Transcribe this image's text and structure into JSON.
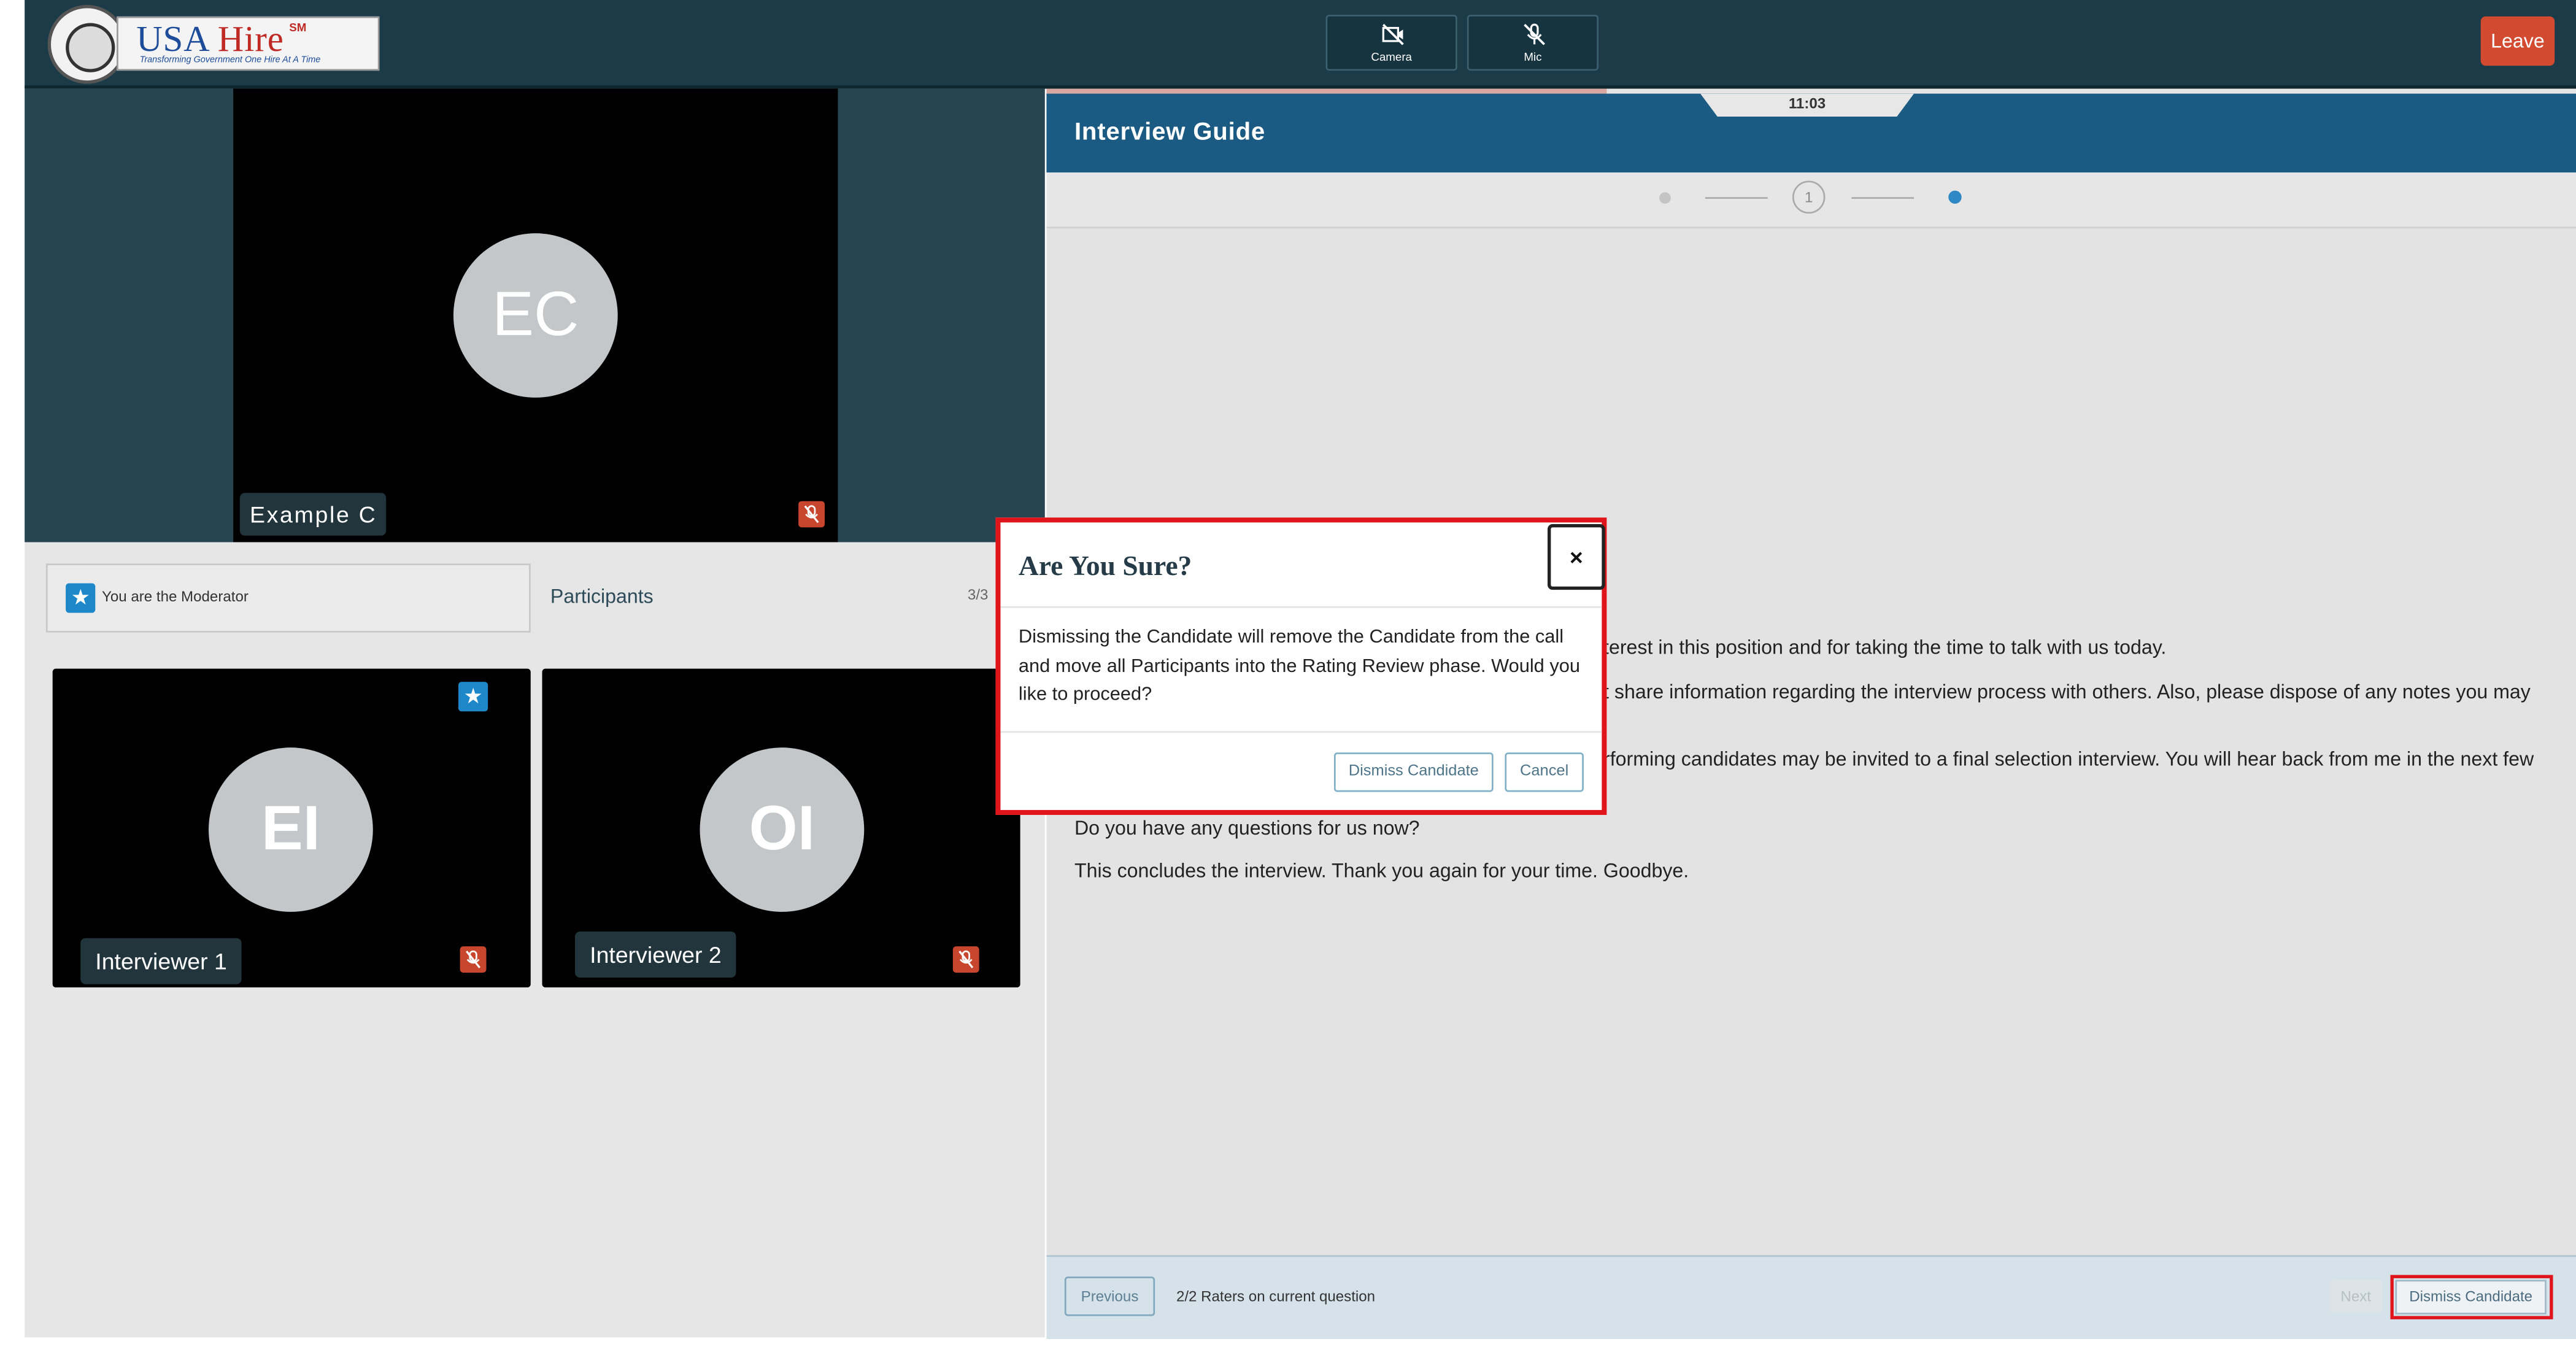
{
  "header": {
    "logo_name": "USA Hire",
    "logo_usa": "USA",
    "logo_hire": "Hire",
    "logo_sm": "SM",
    "logo_tagline": "Transforming Government One Hire At A Time",
    "camera_label": "Camera",
    "mic_label": "Mic",
    "leave_label": "Leave",
    "icons": [
      "camera-off-icon",
      "mic-off-icon"
    ]
  },
  "video": {
    "main_initials": "EC",
    "main_name": "Example C",
    "moderator_text": "You are the Moderator",
    "participants_title": "Participants",
    "participants_count": "3/3",
    "tiles": [
      {
        "initials": "EI",
        "name": "Interviewer 1",
        "is_moderator": true,
        "muted": true
      },
      {
        "initials": "OI",
        "name": "Interviewer 2",
        "is_moderator": false,
        "muted": true
      }
    ]
  },
  "guide": {
    "title": "Interview Guide",
    "timer": "11:03",
    "step_number": "1",
    "lines": [
      "terest in this position and for taking the time to talk with us today.",
      "t share information regarding the interview process with others.  Also, please dispose of any notes you may",
      "rforming candidates may be invited to a final selection interview. You will hear back from me in the next few",
      "Do you have any questions for us now?",
      "This concludes the interview. Thank you again for your time. Goodbye."
    ]
  },
  "footer": {
    "previous_label": "Previous",
    "raters_text": "2/2 Raters on current question",
    "next_label": "Next",
    "dismiss_label": "Dismiss Candidate"
  },
  "modal": {
    "title": "Are You Sure?",
    "close_label": "×",
    "body": "Dismissing the Candidate will remove the Candidate from the call and move all Participants into the Rating Review phase. Would you like to proceed?",
    "dismiss_label": "Dismiss Candidate",
    "cancel_label": "Cancel"
  },
  "colors": {
    "topbar": "#1b3b48",
    "guide_header": "#1b5a82",
    "leave": "#d24a2f",
    "highlight_red": "#e0141b",
    "moderator_star": "#1d87c9",
    "mute_red": "#c8462e"
  }
}
